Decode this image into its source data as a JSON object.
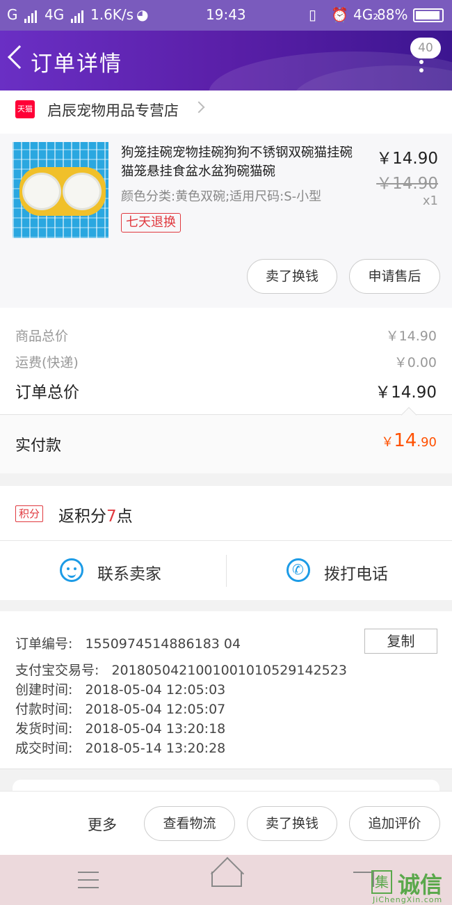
{
  "status_bar": {
    "carrier": "G",
    "network": "4G",
    "speed": "1.6K/s",
    "time": "19:43",
    "network_right": "4G₂",
    "battery": "88%"
  },
  "header": {
    "title": "订单详情",
    "message_count": "40"
  },
  "store": {
    "badge": "天猫",
    "name": "启辰宠物用品专营店"
  },
  "product": {
    "title": "狗笼挂碗宠物挂碗狗狗不锈钢双碗猫挂碗猫笼悬挂食盆水盆狗碗猫碗",
    "sku": "颜色分类:黄色双碗;适用尺码:S-小型",
    "tag": "七天退换",
    "price": "￥14.90",
    "original_price": "￥14.90",
    "quantity": "x1",
    "buttons": {
      "sell": "卖了换钱",
      "after_sale": "申请售后"
    }
  },
  "summary": {
    "goods_label": "商品总价",
    "goods_value": "￥14.90",
    "shipping_label": "运费(快递)",
    "shipping_value": "￥0.00",
    "total_label": "订单总价",
    "total_value": "￥14.90",
    "paid_label": "实付款",
    "paid_currency": "￥",
    "paid_int": "14",
    "paid_dec": ".90"
  },
  "points": {
    "tag": "积分",
    "prefix": "返积分",
    "number": "7",
    "suffix": "点"
  },
  "contact": {
    "seller": "联系卖家",
    "call": "拨打电话"
  },
  "order_info": {
    "order_no_label": "订单编号:",
    "order_no": "1550974514886183 04",
    "copy_label": "复制",
    "alipay_label": "支付宝交易号:",
    "alipay_no": "2018050421001001010529142523",
    "created_label": "创建时间:",
    "created": "2018-05-04 12:05:03",
    "paid_label": "付款时间:",
    "paid": "2018-05-04 12:05:07",
    "shipped_label": "发货时间:",
    "shipped": "2018-05-04 13:20:18",
    "done_label": "成交时间:",
    "done": "2018-05-14 13:20:28"
  },
  "action_bar": {
    "more": "更多",
    "logistics": "查看物流",
    "sell": "卖了换钱",
    "review": "追加评价"
  },
  "watermark": {
    "box": "集",
    "text": "诚信",
    "url": "JiChengXin.com"
  },
  "colors": {
    "header_start": "#6a2fc4",
    "header_end": "#3c1590",
    "price_orange": "#ff5000",
    "tag_red": "#e0383e",
    "contact_blue": "#1c9be6"
  }
}
